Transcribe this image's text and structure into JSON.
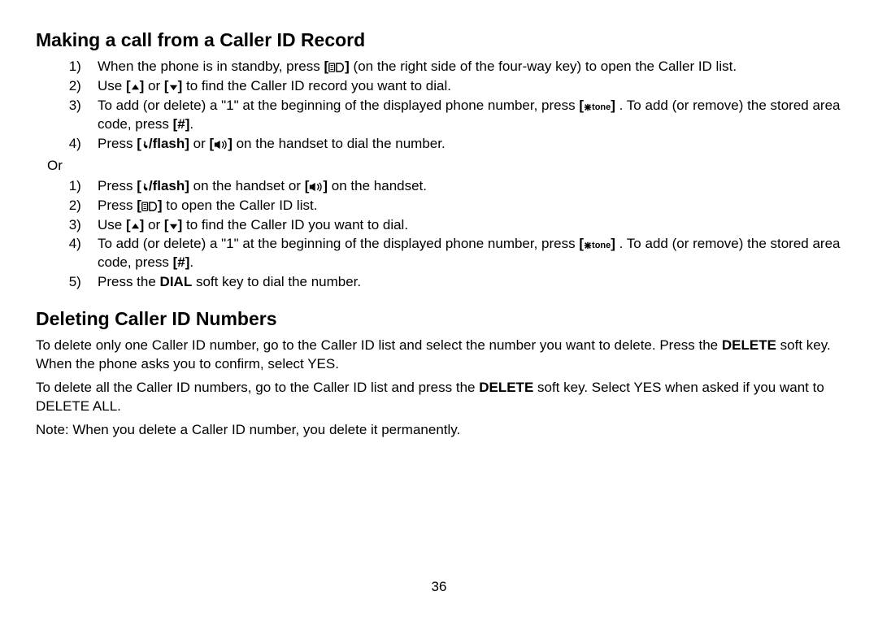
{
  "section1": {
    "heading": "Making a call from a Caller ID Record",
    "list1": [
      {
        "pre": "When the phone is in standby, press ",
        "key": "cid",
        "post": " (on the right side of the four-way key) to open the Caller ID list."
      },
      {
        "pre": "Use ",
        "key": "up",
        "mid": " or ",
        "key2": "down",
        "post": " to find the Caller ID record you want to dial."
      },
      {
        "pre": "To add (or delete) a \"1\" at the beginning of the displayed phone number, press ",
        "key": "star_tone",
        "post": ". To add (or remove) the stored area code, press ",
        "key2": "hash",
        "post2": "."
      },
      {
        "pre": "Press ",
        "key": "flash",
        "mid": " or ",
        "key2": "speaker",
        "post": " on the handset to dial the number."
      }
    ],
    "or": "Or",
    "list2": [
      {
        "pre": "Press ",
        "key": "flash",
        "mid": " on the handset or ",
        "key2": "speaker",
        "post": " on the handset."
      },
      {
        "pre": "Press ",
        "key": "cid",
        "post": " to open the Caller ID list."
      },
      {
        "pre": "Use ",
        "key": "up",
        "mid": " or ",
        "key2": "down",
        "post": " to find the Caller ID you want to dial."
      },
      {
        "pre": "To add (or delete) a \"1\" at the beginning of the displayed phone number, press ",
        "key": "star_tone",
        "post": ". To add (or remove) the stored area code, press ",
        "key2": "hash",
        "post2": "."
      },
      {
        "pre": "Press the ",
        "bold": "DIAL",
        "post": " soft key to dial the number."
      }
    ]
  },
  "section2": {
    "heading": "Deleting Caller ID Numbers",
    "p1a": "To delete only one Caller ID number, go to the Caller ID list and select the number you want to delete. Press the ",
    "p1b": "DELETE",
    "p1c": " soft key. When the phone asks you to confirm, select YES.",
    "p2a": "To delete all the Caller ID numbers, go to the Caller ID list and press the ",
    "p2b": "DELETE",
    "p2c": " soft key. Select YES when asked if you want to DELETE ALL.",
    "p3": "Note: When you delete a Caller ID number, you delete it permanently."
  },
  "page_number": "36",
  "keys": {
    "flash_label": "/flash",
    "tone_label": "tone"
  }
}
